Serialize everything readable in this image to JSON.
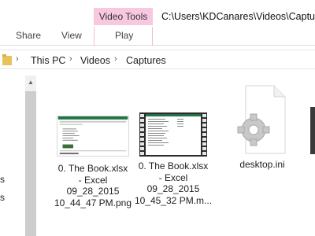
{
  "window": {
    "context_tab_group": "Video Tools",
    "path_title": "C:\\Users\\KDCanares\\Videos\\Captures"
  },
  "ribbon": {
    "tabs": [
      "Share",
      "View",
      "Play"
    ]
  },
  "address": {
    "crumbs": [
      "This PC",
      "Videos",
      "Captures"
    ]
  },
  "navpane": {
    "visible_fragments": [
      "s",
      "s"
    ]
  },
  "files": [
    {
      "name": "0. The  Book.xlsx - Excel 09_28_2015 10_44_47 PM.png",
      "lines": [
        "0. The  Book.xlsx",
        "- Excel",
        "09_28_2015",
        "10_44_47 PM.png"
      ],
      "kind": "image"
    },
    {
      "name": "0. The  Book.xlsx - Excel 09_28_2015 10_45_32 PM.m...",
      "lines": [
        "0. The  Book.xlsx",
        "- Excel",
        "09_28_2015",
        "10_45_32 PM.m..."
      ],
      "kind": "video"
    },
    {
      "name": "desktop.ini",
      "lines": [
        "desktop.ini"
      ],
      "kind": "settings"
    }
  ],
  "colors": {
    "context_tab": "#f7c8e0",
    "folder_yellow": "#e8c25a"
  },
  "icons": [
    "folder-icon",
    "chevron-right-icon",
    "scroll-up-icon",
    "spreadsheet-thumbnail-icon",
    "video-filmstrip-icon",
    "gear-settings-icon"
  ]
}
